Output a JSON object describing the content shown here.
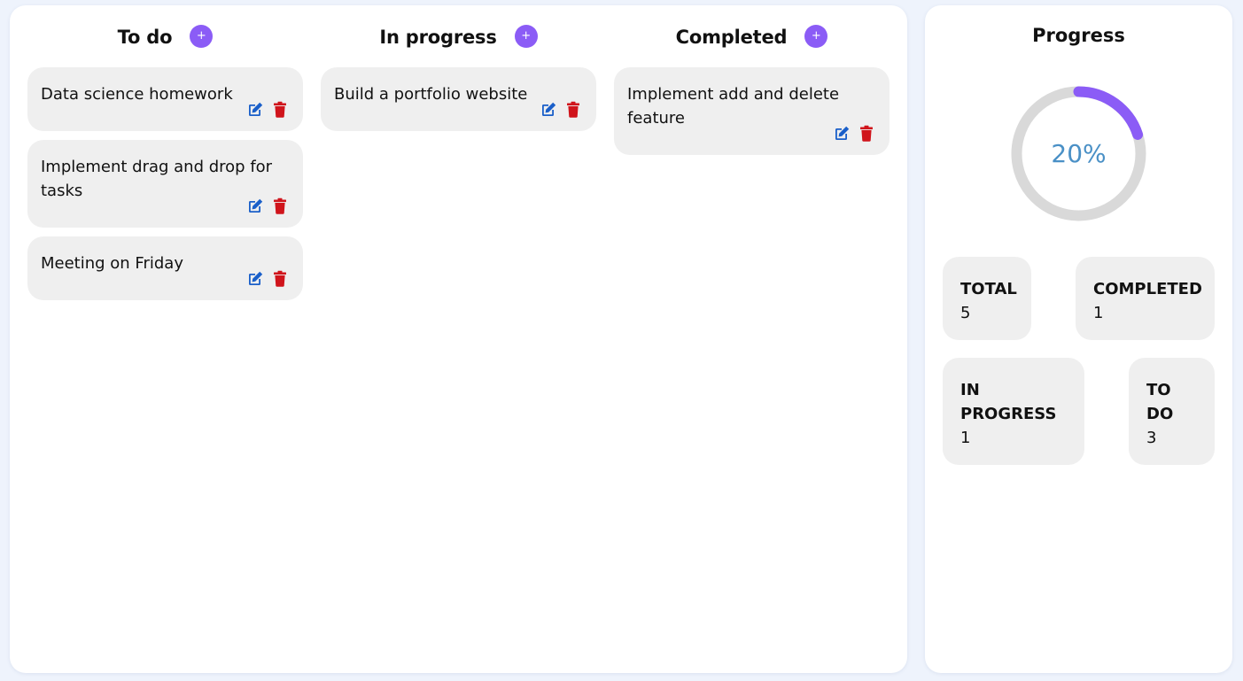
{
  "columns": [
    {
      "title": "To do",
      "add_label": "+",
      "cards": [
        {
          "text": "Data science homework"
        },
        {
          "text": "Implement drag and drop for tasks"
        },
        {
          "text": "Meeting on Friday"
        }
      ]
    },
    {
      "title": "In progress",
      "add_label": "+",
      "cards": [
        {
          "text": "Build a portfolio website"
        }
      ]
    },
    {
      "title": "Completed",
      "add_label": "+",
      "cards": [
        {
          "text": "Implement add and delete feature"
        }
      ]
    }
  ],
  "progress": {
    "title": "Progress",
    "percent_label": "20%",
    "percent": 20,
    "ring_color": "#8b5cf6",
    "track_color": "#d9d9d9",
    "stats": {
      "total": {
        "label": "TOTAL",
        "value": "5"
      },
      "completed": {
        "label": "COMPLETED",
        "value": "1"
      },
      "in_progress": {
        "label": "IN PROGRESS",
        "value": "1"
      },
      "todo": {
        "label": "TO DO",
        "value": "3"
      }
    }
  },
  "colors": {
    "accent": "#8b5cf6",
    "edit_icon": "#1a5fc9",
    "delete_icon": "#d0141b",
    "card_bg": "#efefef"
  },
  "icons": {
    "add": "plus-icon",
    "edit": "edit-icon",
    "delete": "trash-icon"
  }
}
